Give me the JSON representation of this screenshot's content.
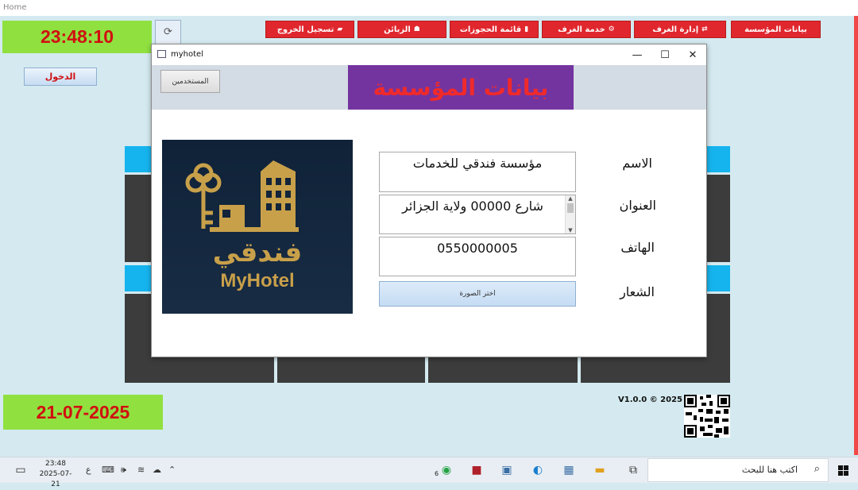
{
  "window": {
    "title": "Home"
  },
  "nav": {
    "items": [
      {
        "label": "بيانات المؤسسة",
        "icon": ""
      },
      {
        "label": "إدارة الغرف",
        "icon": "⇄"
      },
      {
        "label": "خدمة الغرف",
        "icon": "⚙"
      },
      {
        "label": "قائمة الحجوزات",
        "icon": "▮"
      },
      {
        "label": "الزبائن",
        "icon": "☗"
      },
      {
        "label": "تسجيل الخروج",
        "icon": "▰"
      }
    ]
  },
  "clock": {
    "time": "23:48:10",
    "date": "21-07-2025"
  },
  "login_label": "الدخول",
  "version": "V1.0.0 © 2025",
  "dialog": {
    "title": "myhotel",
    "users_button": "المستخدمين",
    "banner": "بيانات المؤسسة",
    "labels": {
      "name": "الاسم",
      "address": "العنوان",
      "phone": "الهاتف",
      "logo": "الشعار"
    },
    "values": {
      "name": "مؤسسة فندقي للخدمات",
      "address": "شارع 00000 ولاية الجزائر",
      "phone": "0550000005"
    },
    "pick_image_button": "اختر الصورة",
    "logo_text": {
      "arabic": "فندقي",
      "latin": "MyHotel"
    },
    "controls": {
      "minimize": "—",
      "maximize": "☐",
      "close": "✕"
    }
  },
  "taskbar": {
    "search_placeholder": "اكتب هنا للبحث",
    "time": "23:48",
    "date": "2025-07-21",
    "lang": "ع",
    "badge": "6"
  },
  "colors": {
    "accent_red": "#e0272e",
    "clock_bg": "#90e040",
    "banner_bg": "#7434a0",
    "tile": "#3c3c3c",
    "cyan": "#16b4ee"
  }
}
